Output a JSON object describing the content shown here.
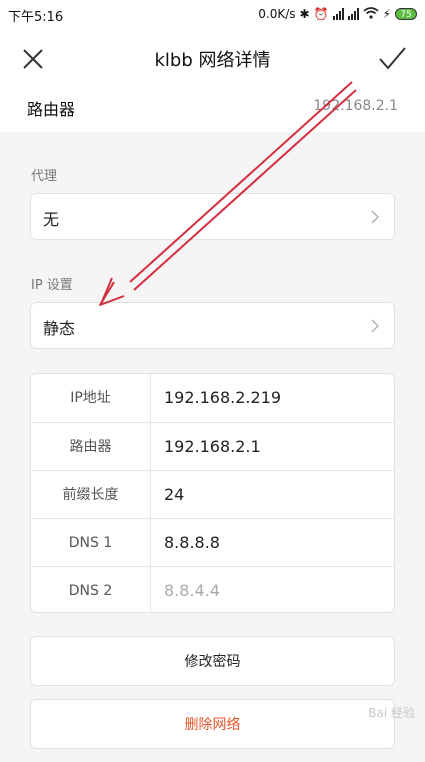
{
  "statusbar": {
    "time": "下午5:16",
    "speed": "0.0K/s",
    "battery": "75"
  },
  "header": {
    "title": "klbb  网络详情"
  },
  "router_row": {
    "label": "路由器",
    "value": "192.168.2.1"
  },
  "proxy": {
    "label": "代理",
    "value": "无"
  },
  "ip_settings": {
    "label": "IP 设置",
    "value": "静态"
  },
  "details": [
    {
      "label": "IP地址",
      "value": "192.168.2.219"
    },
    {
      "label": "路由器",
      "value": "192.168.2.1"
    },
    {
      "label": "前缀长度",
      "value": "24"
    },
    {
      "label": "DNS 1",
      "value": "8.8.8.8"
    },
    {
      "label": "DNS 2",
      "value": "8.8.4.4"
    }
  ],
  "buttons": {
    "change_password": "修改密码",
    "delete_network": "删除网络"
  },
  "colors": {
    "accent_red": "#e4572e",
    "arrow_red": "#d32f3f",
    "battery_green": "#5ebc43"
  },
  "watermark": "Bai 经验"
}
